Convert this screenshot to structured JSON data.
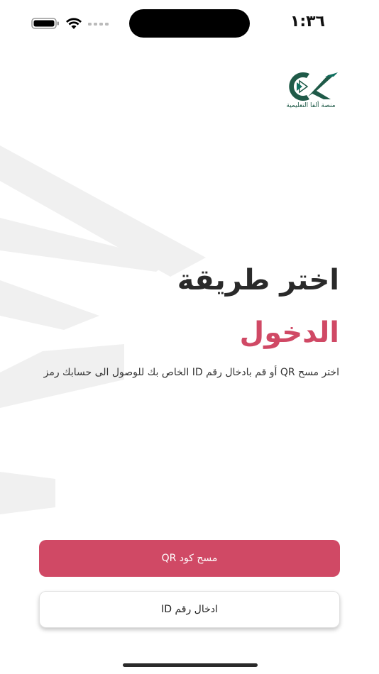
{
  "status_bar": {
    "time": "١:٣٦",
    "icons": [
      "battery-icon",
      "wifi-icon",
      "signal-icon"
    ]
  },
  "logo": {
    "caption": "منصة ألفا التعليمية",
    "colors": {
      "green": "#1f5a48",
      "teal": "#0f7060"
    }
  },
  "login": {
    "title": "اختر طريقة",
    "subtitle": "الدخول",
    "description": "اختر مسح QR أو قم بادخال رقم ID الخاص بك للوصول الى حسابك رمز"
  },
  "buttons": {
    "scan_qr_label": "مسح كود QR",
    "enter_id_label": "ادخال رقم ID"
  },
  "colors": {
    "accent": "#d04965",
    "title_text": "#2a2a2a",
    "background": "#ffffff"
  }
}
